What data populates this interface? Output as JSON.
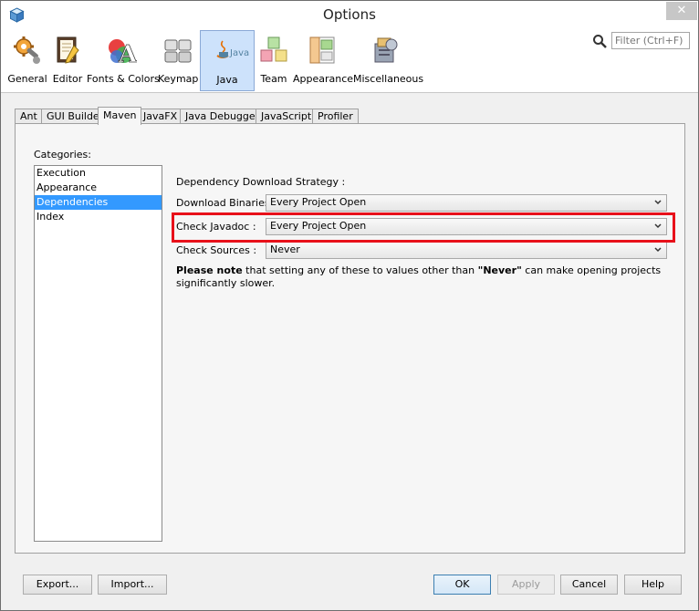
{
  "window": {
    "title": "Options",
    "close_glyph": "✕"
  },
  "toolbar": {
    "categories": [
      {
        "label": "General",
        "icon": "gear-icon"
      },
      {
        "label": "Editor",
        "icon": "editor-icon"
      },
      {
        "label": "Fonts & Colors",
        "icon": "fonts-colors-icon"
      },
      {
        "label": "Keymap",
        "icon": "keymap-icon"
      },
      {
        "label": "Java",
        "icon": "java-icon",
        "selected": true
      },
      {
        "label": "Team",
        "icon": "team-icon"
      },
      {
        "label": "Appearance",
        "icon": "appearance-icon"
      },
      {
        "label": "Miscellaneous",
        "icon": "miscellaneous-icon"
      }
    ],
    "java_logo_text": "Java",
    "filter_placeholder": "Filter (Ctrl+F)"
  },
  "tabs": [
    "Ant",
    "GUI Builder",
    "Maven",
    "JavaFX",
    "Java Debugger",
    "JavaScript",
    "Profiler"
  ],
  "active_tab": "Maven",
  "panel": {
    "categories_label": "Categories:",
    "categories": [
      "Execution",
      "Appearance",
      "Dependencies",
      "Index"
    ],
    "selected_category": "Dependencies",
    "heading": "Dependency Download Strategy :",
    "download_binaries": {
      "label": "Download Binaries :",
      "value": "Every Project Open"
    },
    "check_javadoc": {
      "label": "Check Javadoc :",
      "value": "Every Project Open"
    },
    "check_sources": {
      "label": "Check Sources :",
      "value": "Never"
    },
    "note": {
      "bold_prefix": "Please note",
      "text_mid": " that setting any of these to values other than ",
      "bold_value": "\"Never\"",
      "text_end": " can make opening projects significantly slower."
    }
  },
  "buttons": {
    "export": "Export...",
    "import": "Import...",
    "ok": "OK",
    "apply": "Apply",
    "cancel": "Cancel",
    "help": "Help"
  },
  "colors": {
    "highlight": "#e8101a",
    "selection": "#3399ff",
    "selected_category_bg": "#cde2fb"
  }
}
